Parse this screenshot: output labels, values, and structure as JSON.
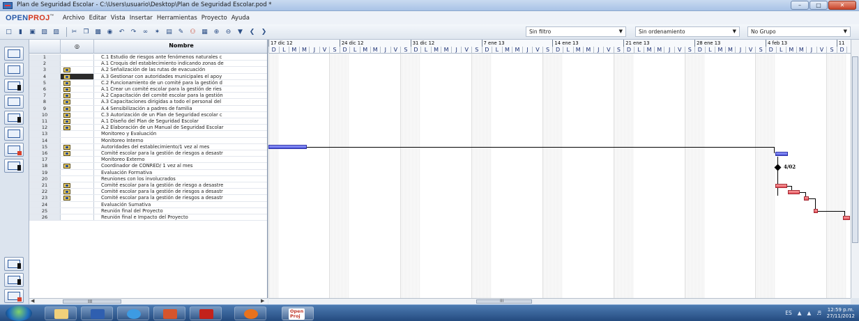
{
  "window": {
    "title": "Plan de Seguridad Escolar - C:\\Users\\usuario\\Desktop\\Plan de Seguridad Escolar.pod *",
    "min": "–",
    "max": "□",
    "close": "✕"
  },
  "menubar": {
    "logo_open": "OPEN",
    "logo_proj": "PROJ",
    "logo_tm": "™",
    "items": [
      "Archivo",
      "Editar",
      "Vista",
      "Insertar",
      "Herramientas",
      "Proyecto",
      "Ayuda"
    ]
  },
  "toolbar": {
    "filter": "Sin filtro",
    "sort": "Sin ordenamiento",
    "group": "No Grupo"
  },
  "table": {
    "header_indicator": "◎",
    "header_name": "Nombre",
    "rows": [
      {
        "id": "1",
        "name": "C.1 Estudio de riesgos ante fenómenos naturales c",
        "ind": false
      },
      {
        "id": "2",
        "name": "A.1 Croquis del establecimiento indicando zonas de",
        "ind": false
      },
      {
        "id": "3",
        "name": "A.2 Señalización de las rutas de evacuación",
        "ind": true
      },
      {
        "id": "4",
        "name": "A.3 Gestionar con autoridades municipales el apoy",
        "ind": true
      },
      {
        "id": "5",
        "name": "C.2 Funcionamiento de un comité para la gestión d",
        "ind": true
      },
      {
        "id": "6",
        "name": "A.1 Crear un comité escolar para la gestión de ries",
        "ind": true
      },
      {
        "id": "7",
        "name": "A.2 Capacitación del comité escolar para la gestión",
        "ind": true
      },
      {
        "id": "8",
        "name": "A.3 Capacitaciones dirigidas a todo el personal del",
        "ind": true
      },
      {
        "id": "9",
        "name": "A.4 Sensibilización a padres de familia",
        "ind": true
      },
      {
        "id": "10",
        "name": "C.3 Autorización de un Plan de Seguridad escolar c",
        "ind": true
      },
      {
        "id": "11",
        "name": "A.1 Diseño del Plan de Seguridad Escolar",
        "ind": true
      },
      {
        "id": "12",
        "name": "A.2 Elaboración de un Manual de Seguridad Escolar",
        "ind": true
      },
      {
        "id": "13",
        "name": "Monitoreo y Evaluación",
        "ind": false
      },
      {
        "id": "14",
        "name": "Monitoreo Interno",
        "ind": false
      },
      {
        "id": "15",
        "name": "Autoridades del establecimiento/1 vez al mes",
        "ind": true
      },
      {
        "id": "16",
        "name": "Comité escolar para la gestión de riesgos a desastr",
        "ind": true
      },
      {
        "id": "17",
        "name": "Monitoreo Externo",
        "ind": false
      },
      {
        "id": "18",
        "name": "Coordinador de CONRED/ 1 vez al mes",
        "ind": true
      },
      {
        "id": "19",
        "name": "Evaluación Formativa",
        "ind": false
      },
      {
        "id": "20",
        "name": "Reuniones con los involucrados",
        "ind": false
      },
      {
        "id": "21",
        "name": "Comité escolar para la gestión de riesgo a desastre",
        "ind": true
      },
      {
        "id": "22",
        "name": "Comité escolar para la gestión de riesgos a desastr",
        "ind": true
      },
      {
        "id": "23",
        "name": "Comité escolar para la gestión de riesgos a desastr",
        "ind": true
      },
      {
        "id": "24",
        "name": "Evaluación Sumativa",
        "ind": false
      },
      {
        "id": "25",
        "name": "Reunión final del Proyecto",
        "ind": false
      },
      {
        "id": "26",
        "name": "Reunión final e Impacto del Proyecto",
        "ind": false
      }
    ],
    "scroll_mid": "III"
  },
  "gantt": {
    "weeks": [
      "17 dic 12",
      "24 dic 12",
      "31 dic 12",
      "7 ene 13",
      "14 ene 13",
      "21 ene 13",
      "28 ene 13",
      "4 feb 13",
      "11"
    ],
    "days": [
      "D",
      "L",
      "M",
      "M",
      "J",
      "V",
      "S"
    ],
    "milestone_label": "4/02",
    "scroll_mid": "III",
    "colors": {
      "task": "#e5505a",
      "summary": "#4b54d8"
    }
  },
  "taskbar": {
    "lang": "ES",
    "time": "12:59 p.m.",
    "date": "27/11/2012",
    "openproj_label_1": "Open",
    "openproj_label_2": "Proj"
  }
}
